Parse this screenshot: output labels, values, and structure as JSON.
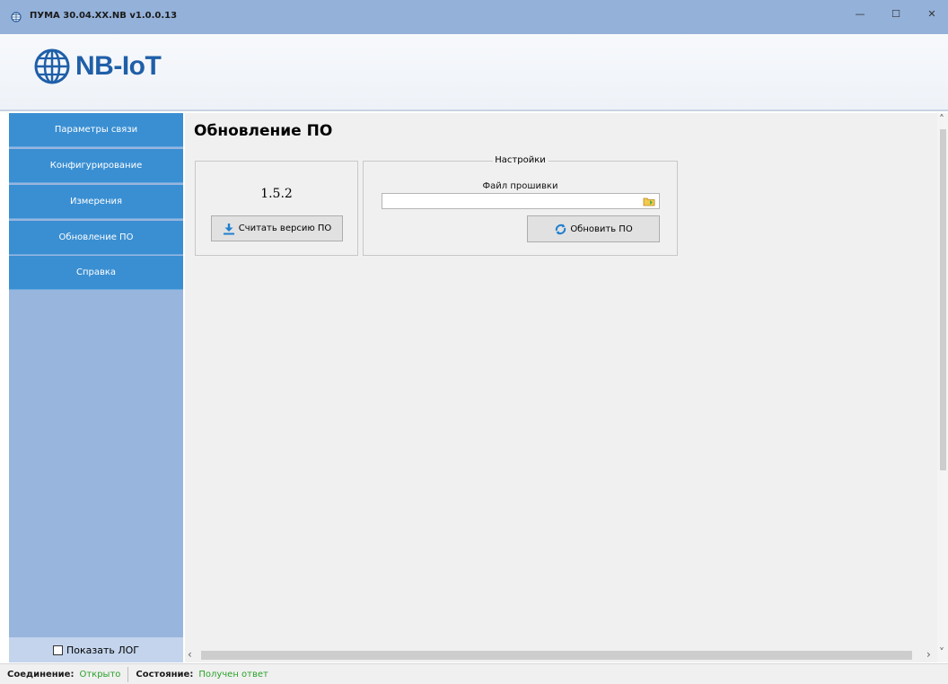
{
  "window": {
    "title": "ПУМА 30.04.XX.NB v1.0.0.13",
    "minimize_glyph": "—",
    "maximize_glyph": "☐",
    "close_glyph": "✕"
  },
  "logo": {
    "text": "NB-IoT",
    "icon": "globe-icon"
  },
  "sidebar": {
    "items": [
      {
        "label": "Параметры связи"
      },
      {
        "label": "Конфигурирование"
      },
      {
        "label": "Измерения"
      },
      {
        "label": "Обновление ПО"
      },
      {
        "label": "Справка"
      }
    ],
    "show_log_label": "Показать ЛОГ",
    "show_log_checked": false
  },
  "main": {
    "title": "Обновление ПО",
    "version_panel": {
      "version": "1.5.2",
      "read_button_label": "Считать версию ПО",
      "read_button_icon": "download-arrow-icon"
    },
    "settings_panel": {
      "legend": "Настройки",
      "file_label": "Файл прошивки",
      "file_value": "",
      "browse_icon": "folder-browse-icon",
      "update_button_label": "Обновить ПО",
      "update_button_icon": "refresh-icon"
    }
  },
  "statusbar": {
    "connection_label": "Соединение:",
    "connection_value": "Открыто",
    "state_label": "Состояние:",
    "state_value": "Получен ответ"
  },
  "colors": {
    "titlebar": "#93b1d9",
    "sidebar_bg": "#98b5dd",
    "nav_item": "#3a8fd2",
    "status_ok": "#2aa02a",
    "logo_text": "#1f5fa8"
  }
}
